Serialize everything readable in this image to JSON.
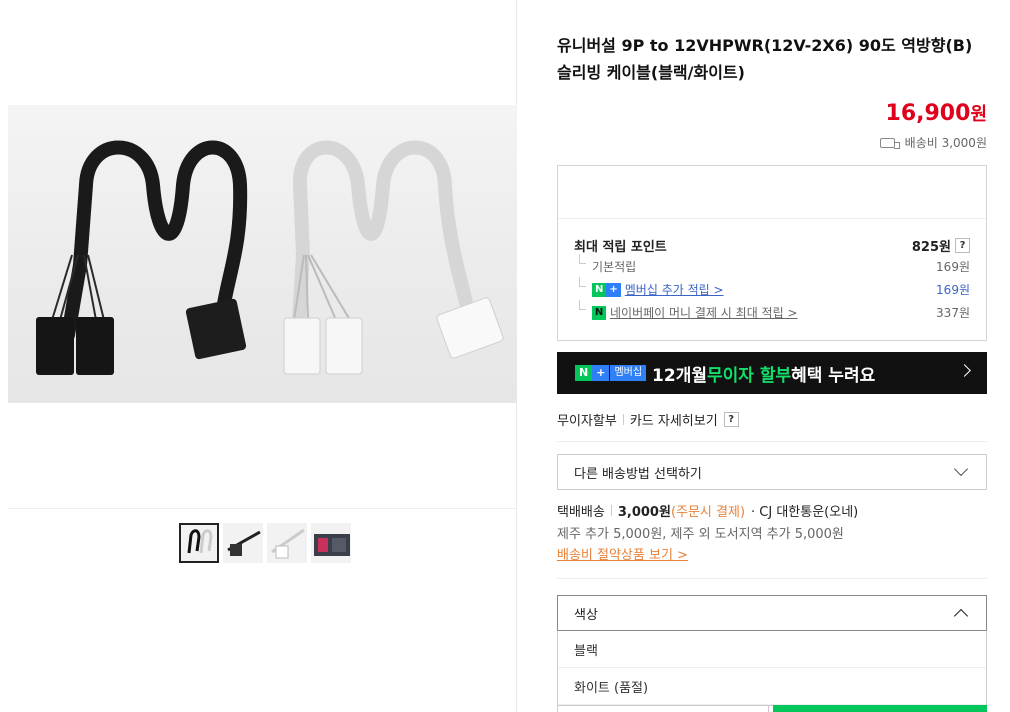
{
  "product": {
    "title_line1": "유니버설 9P to 12VHPWR(12V-2X6) 90도 역방향(B)",
    "title_line2": "슬리빙 케이블(블랙/화이트)",
    "price": "16,900",
    "price_unit": "원",
    "shipping_fee": "배송비 3,000원"
  },
  "points": {
    "max_label": "최대 적립 포인트",
    "max_value": "825원",
    "help": "?",
    "basic_label": "기본적립",
    "basic_value": "169원",
    "member_badge_n": "N",
    "member_badge_plus": "+",
    "member_label": "멤버십 추가 적립 >",
    "member_value": "169원",
    "npay_badge": "N",
    "npay_label": "네이버페이 머니 결제 시 최대 적립 >",
    "npay_value": "337원"
  },
  "banner": {
    "badge_n": "N",
    "badge_plus": "+",
    "badge_member": "멤버십",
    "text_a": "12개월 ",
    "text_highlight": "무이자 할부",
    "text_b": " 혜택 누려요"
  },
  "installment": {
    "label": "무이자할부",
    "card_detail": "카드 자세히보기",
    "help": "?"
  },
  "shipping": {
    "select_label": "다른 배송방법 선택하기",
    "method": "택배배송",
    "amount": "3,000원",
    "payment_note": "(주문시 결제)",
    "carrier": "· CJ 대한통운(오네)",
    "extra": "제주 추가 5,000원, 제주 외 도서지역 추가 5,000원",
    "save_link": "배송비 절약상품 보기 >"
  },
  "color_select": {
    "label": "색상",
    "options": [
      "블랙",
      "화이트 (품절)"
    ]
  },
  "colors": {
    "price_red": "#e0001b",
    "naver_green": "#03c75a",
    "member_blue": "#2f7ff7",
    "link_orange": "#e8823a"
  }
}
